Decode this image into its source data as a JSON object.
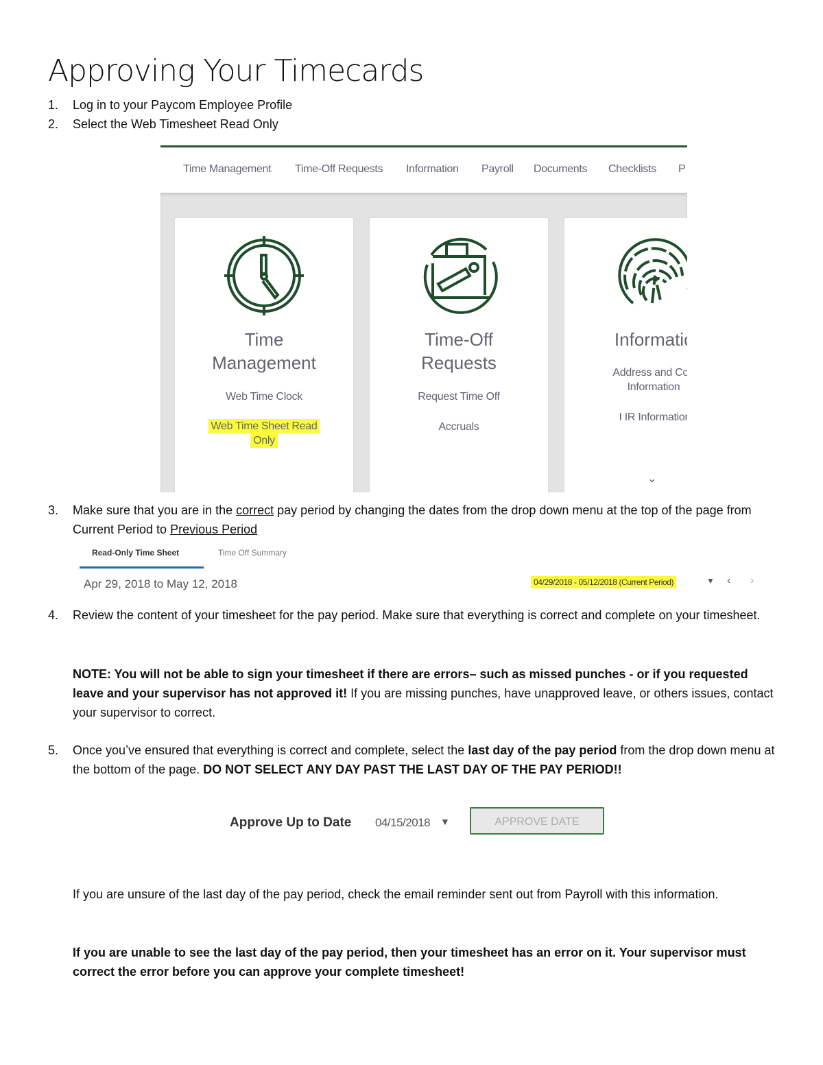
{
  "document": {
    "title": "Approving Your Timecards",
    "steps": [
      {
        "num": "1.",
        "text": "Log in to your Paycom Employee Profile"
      },
      {
        "num": "2.",
        "text": "Select the Web Timesheet Read Only"
      },
      {
        "num": "3.",
        "text_a": "Make sure that you are in the ",
        "text_u1": "correct",
        "text_b": " pay period by changing the dates from the drop down menu at the top of the page from Current Period to ",
        "text_u2": "Previous Period"
      },
      {
        "num": "4.",
        "text": "Review the content of your timesheet for the pay period. Make sure that everything is correct and complete on your timesheet."
      },
      {
        "num": "5.",
        "text_a": "Once you’ve ensured that everything is correct and complete, select the ",
        "text_b1": "last day of the pay period",
        "text_c": " from the drop down menu at the bottom of the page. ",
        "text_b2": "DO NOT SELECT ANY DAY PAST THE LAST DAY OF THE PAY PERIOD!!"
      }
    ],
    "note": {
      "bold": "NOTE: You will not be able to sign your timesheet if there are errors– such as missed punches - or if you requested leave and your supervisor has not approved it!",
      "normal": " If you are missing punches, have unapproved leave, or others issues, contact your supervisor to correct."
    },
    "unsure_text": "If you are unsure of the last day of the pay period, check the email reminder sent out from Payroll with this information.",
    "error_text": "If you are unable to see the last day of the pay period, then your timesheet has an error on it. Your supervisor must correct the error before you can approve your complete timesheet!"
  },
  "screenshot_dashboard": {
    "nav_items": [
      "Time Management",
      "Time-Off Requests",
      "Information",
      "Payroll",
      "Documents",
      "Checklists",
      "P"
    ],
    "cards": [
      {
        "icon": "clock-icon",
        "title_line1": "Time",
        "title_line2": "Management",
        "links": [
          "Web Time Clock",
          "Web Time Sheet Read",
          "Only"
        ]
      },
      {
        "icon": "suitcase-icon",
        "title_line1": "Time-Off",
        "title_line2": "Requests",
        "links": [
          "Request Time Off",
          "Accruals"
        ]
      },
      {
        "icon": "fingerprint-icon",
        "title_line1": "Informatic",
        "links": [
          "Address and Con",
          "Information",
          "I IR Informatior"
        ]
      }
    ],
    "accent_color": "#1f5a2a",
    "highlight_color": "#fbfb3c"
  },
  "screenshot_timesheet": {
    "tabs": [
      "Read-Only Time Sheet",
      "Time Off Summary"
    ],
    "date_range": "Apr 29, 2018 to May 12, 2018",
    "period_select": "04/29/2018 - 05/12/2018 (Current Period)",
    "caret": "▼",
    "prev": "‹",
    "next": "›"
  },
  "screenshot_approve": {
    "label": "Approve Up to Date",
    "date_value": "04/15/2018",
    "caret": "▼",
    "button": "APPROVE DATE"
  }
}
